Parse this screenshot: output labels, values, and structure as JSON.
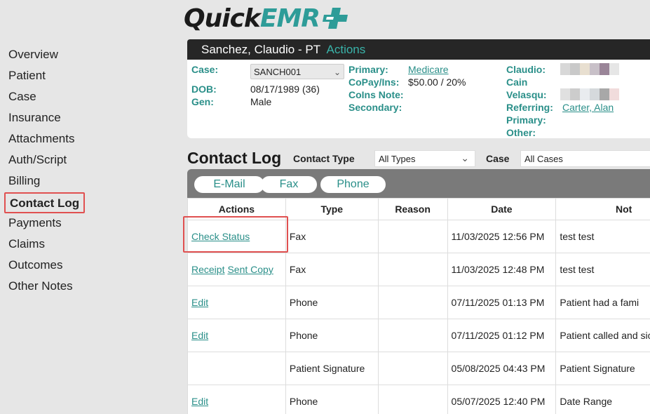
{
  "brand": {
    "part1": "Quick",
    "part2": "EMR"
  },
  "sidebar": {
    "items": [
      {
        "label": "Overview"
      },
      {
        "label": "Patient"
      },
      {
        "label": "Case"
      },
      {
        "label": "Insurance"
      },
      {
        "label": "Attachments"
      },
      {
        "label": "Auth/Script"
      },
      {
        "label": "Billing"
      },
      {
        "label": "Contact Log",
        "active": true
      },
      {
        "label": "Payments"
      },
      {
        "label": "Claims"
      },
      {
        "label": "Outcomes"
      },
      {
        "label": "Other Notes"
      }
    ]
  },
  "patient": {
    "name": "Sanchez, Claudio - PT",
    "actions": "Actions",
    "case_label": "Case:",
    "case_value": "SANCH001",
    "dob_label": "DOB:",
    "dob_value": "08/17/1989 (36)",
    "gen_label": "Gen:",
    "gen_value": "Male",
    "primary_label": "Primary:",
    "primary_value": "Medicare",
    "copay_label": "CoPay/Ins:",
    "copay_value": "$50.00 / 20%",
    "coins_label": "CoIns Note:",
    "secondary_label": "Secondary:",
    "claudio_label": "Claudio:",
    "cain_label": "Cain",
    "velasqu_label": "Velasqu:",
    "referring_label": "Referring:",
    "referring_value": "Carter, Alan",
    "primary2_label": "Primary:",
    "other_label": "Other:"
  },
  "contact_log": {
    "title": "Contact Log",
    "contact_type_label": "Contact Type",
    "contact_type_value": "All Types",
    "case_label": "Case",
    "case_value": "All Cases",
    "buttons": {
      "email": "E-Mail",
      "fax": "Fax",
      "phone": "Phone"
    },
    "columns": [
      "Actions",
      "Type",
      "Reason",
      "Date",
      "Not"
    ],
    "rows": [
      {
        "actions": [
          "Check Status"
        ],
        "type": "Fax",
        "reason": "",
        "date": "11/03/2025 12:56 PM",
        "notes": "test test"
      },
      {
        "actions": [
          "Receipt",
          "Sent Copy"
        ],
        "type": "Fax",
        "reason": "",
        "date": "11/03/2025 12:48 PM",
        "notes": "test test"
      },
      {
        "actions": [
          "Edit"
        ],
        "type": "Phone",
        "reason": "",
        "date": "07/11/2025 01:13 PM",
        "notes": "Patient had a fami"
      },
      {
        "actions": [
          "Edit"
        ],
        "type": "Phone",
        "reason": "",
        "date": "07/11/2025 01:12 PM",
        "notes": "Patient called and sick."
      },
      {
        "actions": [],
        "type": "Patient Signature",
        "reason": "",
        "date": "05/08/2025 04:43 PM",
        "notes": "Patient Signature"
      },
      {
        "actions": [
          "Edit"
        ],
        "type": "Phone",
        "reason": "",
        "date": "05/07/2025 12:40 PM",
        "notes": "Date Range"
      }
    ]
  },
  "colors": {
    "accent": "#2a8f89",
    "highlight": "#e05050",
    "header_bar": "#262626"
  }
}
